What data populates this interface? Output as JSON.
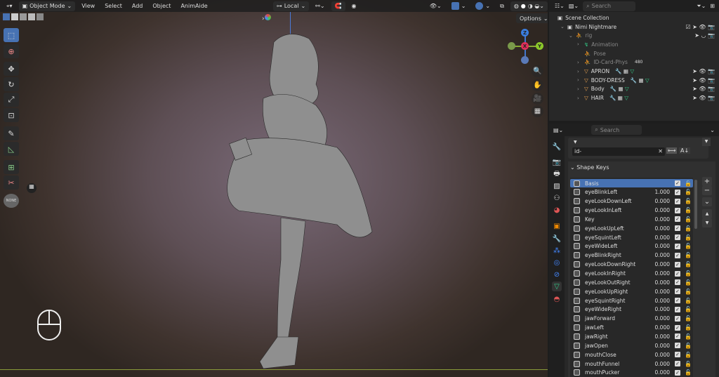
{
  "viewport": {
    "header": {
      "mode": "Object Mode",
      "menus": [
        "View",
        "Select",
        "Add",
        "Object",
        "AnimAide"
      ],
      "orientation": "Local"
    },
    "options_label": "Options",
    "gizmo": {
      "z": "Z",
      "x": "X",
      "y": "Y"
    },
    "none_label": "NONE"
  },
  "outliner": {
    "search_placeholder": "Search",
    "root": "Scene Collection",
    "items": [
      {
        "label": "Nimi Nightmare",
        "kind": "collection"
      },
      {
        "label": "rig",
        "kind": "armature"
      },
      {
        "label": "Animation",
        "kind": "anim"
      },
      {
        "label": "Pose",
        "kind": "pose"
      },
      {
        "label": "ID-Card-Phys",
        "kind": "bone",
        "badge": "480"
      },
      {
        "label": "APRON",
        "kind": "mesh"
      },
      {
        "label": "BODY-DRESS",
        "kind": "mesh"
      },
      {
        "label": "Body",
        "kind": "mesh"
      },
      {
        "label": "HAIR",
        "kind": "mesh"
      }
    ]
  },
  "properties": {
    "search_placeholder": "Search",
    "filter_value": "id-",
    "panel_title": "Shape Keys",
    "shape_keys": [
      {
        "name": "Basis",
        "value": "",
        "selected": true
      },
      {
        "name": "eyeBlinkLeft",
        "value": "1.000"
      },
      {
        "name": "eyeLookDownLeft",
        "value": "0.000"
      },
      {
        "name": "eyeLookInLeft",
        "value": "0.000"
      },
      {
        "name": "Key",
        "value": "0.000"
      },
      {
        "name": "eyeLookUpLeft",
        "value": "0.000"
      },
      {
        "name": "eyeSquintLeft",
        "value": "0.000"
      },
      {
        "name": "eyeWideLeft",
        "value": "0.000"
      },
      {
        "name": "eyeBlinkRight",
        "value": "0.000"
      },
      {
        "name": "eyeLookDownRight",
        "value": "0.000"
      },
      {
        "name": "eyeLookInRight",
        "value": "0.000"
      },
      {
        "name": "eyeLookOutRight",
        "value": "0.000"
      },
      {
        "name": "eyeLookUpRight",
        "value": "0.000"
      },
      {
        "name": "eyeSquintRight",
        "value": "0.000"
      },
      {
        "name": "eyeWideRight",
        "value": "0.000"
      },
      {
        "name": "jawForward",
        "value": "0.000"
      },
      {
        "name": "jawLeft",
        "value": "0.000"
      },
      {
        "name": "jawRight",
        "value": "0.000"
      },
      {
        "name": "jawOpen",
        "value": "0.000"
      },
      {
        "name": "mouthClose",
        "value": "0.000"
      },
      {
        "name": "mouthFunnel",
        "value": "0.000"
      },
      {
        "name": "mouthPucker",
        "value": "0.000"
      }
    ]
  }
}
